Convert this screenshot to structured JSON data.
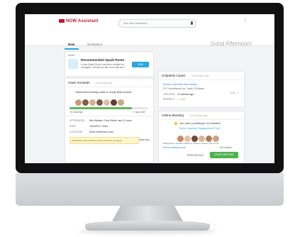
{
  "app": {
    "logo_text": "NOW Assistant",
    "search_placeholder": "Ask Now Assistant...",
    "greeting": "Good Afternoon!",
    "menu_icon": "more-vertical-icon"
  },
  "tabs": [
    {
      "label": "Now",
      "active": true
    },
    {
      "label": "Workplace",
      "active": false
    }
  ],
  "cards": {
    "spark": {
      "header": "Spark",
      "title": "Recommended Spark Room",
      "body": "A new Spark Room has been created for managers. Would you like us to add you?",
      "button": "JOIN"
    },
    "class_reminder": {
      "header": "Class reminder",
      "time": "15 minutes ago",
      "message": "Tomorrow's training class is nearly fully booked.",
      "progress_label": "10 bookings",
      "progress_right": "2 spots left",
      "progress_fraction": 0.8,
      "rows": [
        {
          "key": "ATTENDEES",
          "value": "Bob Walden, Chris Esther, and 12 more"
        },
        {
          "key": "DATE",
          "value": "10/15/2017 11am"
        },
        {
          "key": "LOCATION",
          "value": "Sixth conference room"
        }
      ],
      "warning": "Registration and classroom seats limited to 12 people",
      "warning_button": "View now"
    },
    "helpdesk": {
      "header": "Helpdesk Cases",
      "time": "15 minutes ago",
      "case_title": "Server response time issues",
      "case_sub": "PLC Investments Inc. Justin O'Sullivan",
      "rows": [
        {
          "key": "CREATED",
          "value": "15 minutes ago"
        },
        {
          "key": "PRIORITY",
          "value": "1 - Low"
        }
      ],
      "view_label": "View"
    },
    "online_meeting": {
      "header": "Online Meeting",
      "time": "15 minutes ago",
      "message": "You have a meeting in 15 minutes!",
      "meeting_title": "\"New Customer Engagement Prep\"",
      "participants": "Participants: Caroline Williams, Anthony Nelson and 5 more",
      "link": "Server meeting room",
      "status": "Not started",
      "btn_reschedule": "RESCHEDULE",
      "btn_start": "START MEETING"
    }
  }
}
